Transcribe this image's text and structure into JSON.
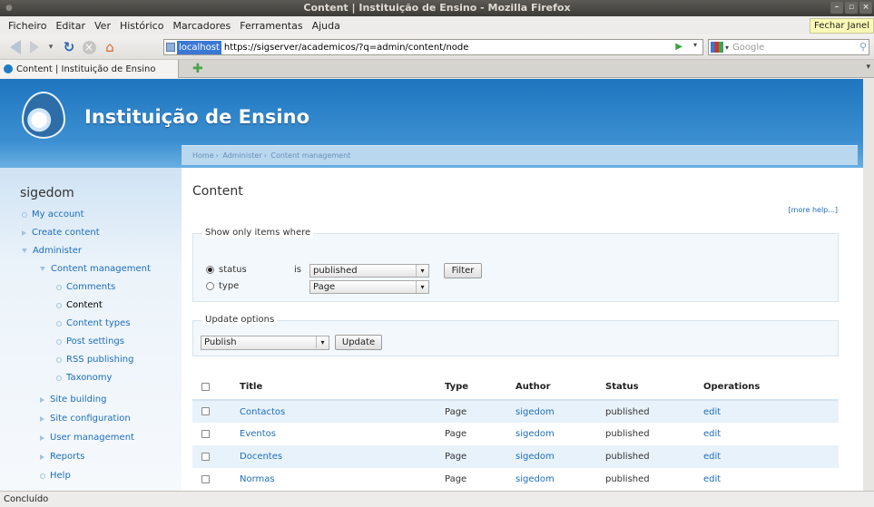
{
  "window": {
    "title": "Content | Instituição de Ensino - Mozilla Firefox"
  },
  "menu": {
    "items": [
      "Ficheiro",
      "Editar",
      "Ver",
      "Histórico",
      "Marcadores",
      "Ferramentas",
      "Ajuda"
    ],
    "fechar": "Fechar Janel"
  },
  "nav": {
    "host": "localhost",
    "url": "https://sigserver/academicos/?q=admin/content/node",
    "search_placeholder": "Google"
  },
  "tab": {
    "label": "Content | Instituição de Ensino"
  },
  "site": {
    "name": "Instituição de Ensino"
  },
  "breadcrumb": [
    "Home",
    "Administer",
    "Content management"
  ],
  "sidebar": {
    "title": "sigedom",
    "items": [
      {
        "label": "My account"
      },
      {
        "label": "Create content"
      },
      {
        "label": "Administer"
      },
      {
        "label": "Content management"
      },
      {
        "label": "Comments"
      },
      {
        "label": "Content"
      },
      {
        "label": "Content types"
      },
      {
        "label": "Post settings"
      },
      {
        "label": "RSS publishing"
      },
      {
        "label": "Taxonomy"
      },
      {
        "label": "Site building"
      },
      {
        "label": "Site configuration"
      },
      {
        "label": "User management"
      },
      {
        "label": "Reports"
      },
      {
        "label": "Help"
      }
    ]
  },
  "content": {
    "title": "Content",
    "more_help": "[more help...]",
    "filter": {
      "legend": "Show only items where",
      "status_label": "status",
      "type_label": "type",
      "is_label": "is",
      "status_value": "published",
      "type_value": "Page",
      "button": "Filter"
    },
    "update": {
      "legend": "Update options",
      "value": "Publish",
      "button": "Update"
    },
    "table": {
      "headers": [
        "Title",
        "Type",
        "Author",
        "Status",
        "Operations"
      ],
      "rows": [
        {
          "title": "Contactos",
          "type": "Page",
          "author": "sigedom",
          "status": "published",
          "op": "edit"
        },
        {
          "title": "Eventos",
          "type": "Page",
          "author": "sigedom",
          "status": "published",
          "op": "edit"
        },
        {
          "title": "Docentes",
          "type": "Page",
          "author": "sigedom",
          "status": "published",
          "op": "edit"
        },
        {
          "title": "Normas",
          "type": "Page",
          "author": "sigedom",
          "status": "published",
          "op": "edit"
        }
      ]
    }
  },
  "status_bar": "Concluído"
}
